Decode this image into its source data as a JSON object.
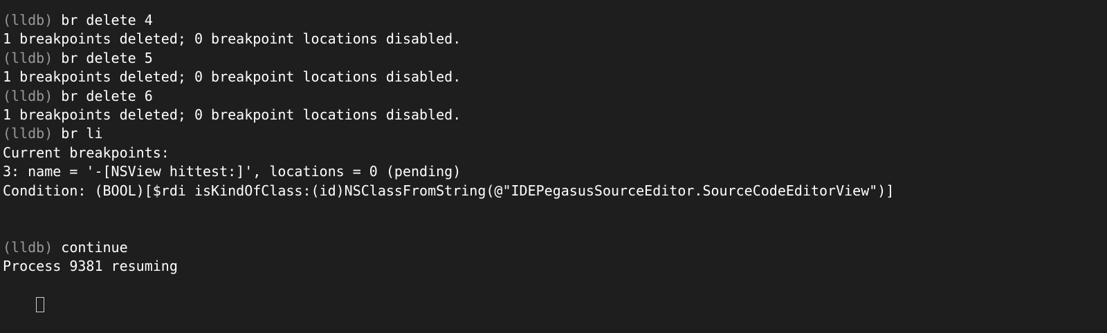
{
  "terminal": {
    "prompt": "(lldb)",
    "lines": [
      {
        "type": "prompt",
        "text": "br delete 4"
      },
      {
        "type": "output",
        "text": "1 breakpoints deleted; 0 breakpoint locations disabled."
      },
      {
        "type": "prompt",
        "text": "br delete 5"
      },
      {
        "type": "output",
        "text": "1 breakpoints deleted; 0 breakpoint locations disabled."
      },
      {
        "type": "prompt",
        "text": "br delete 6"
      },
      {
        "type": "output",
        "text": "1 breakpoints deleted; 0 breakpoint locations disabled."
      },
      {
        "type": "prompt",
        "text": "br li"
      },
      {
        "type": "output",
        "text": "Current breakpoints:"
      },
      {
        "type": "output",
        "text": "3: name = '-[NSView hittest:]', locations = 0 (pending)"
      },
      {
        "type": "output",
        "text": "Condition: (BOOL)[$rdi isKindOfClass:(id)NSClassFromString(@\"IDEPegasusSourceEditor.SourceCodeEditorView\")]"
      },
      {
        "type": "output",
        "text": ""
      },
      {
        "type": "output",
        "text": ""
      },
      {
        "type": "prompt",
        "text": "continue"
      },
      {
        "type": "output",
        "text": "Process 9381 resuming"
      }
    ]
  }
}
